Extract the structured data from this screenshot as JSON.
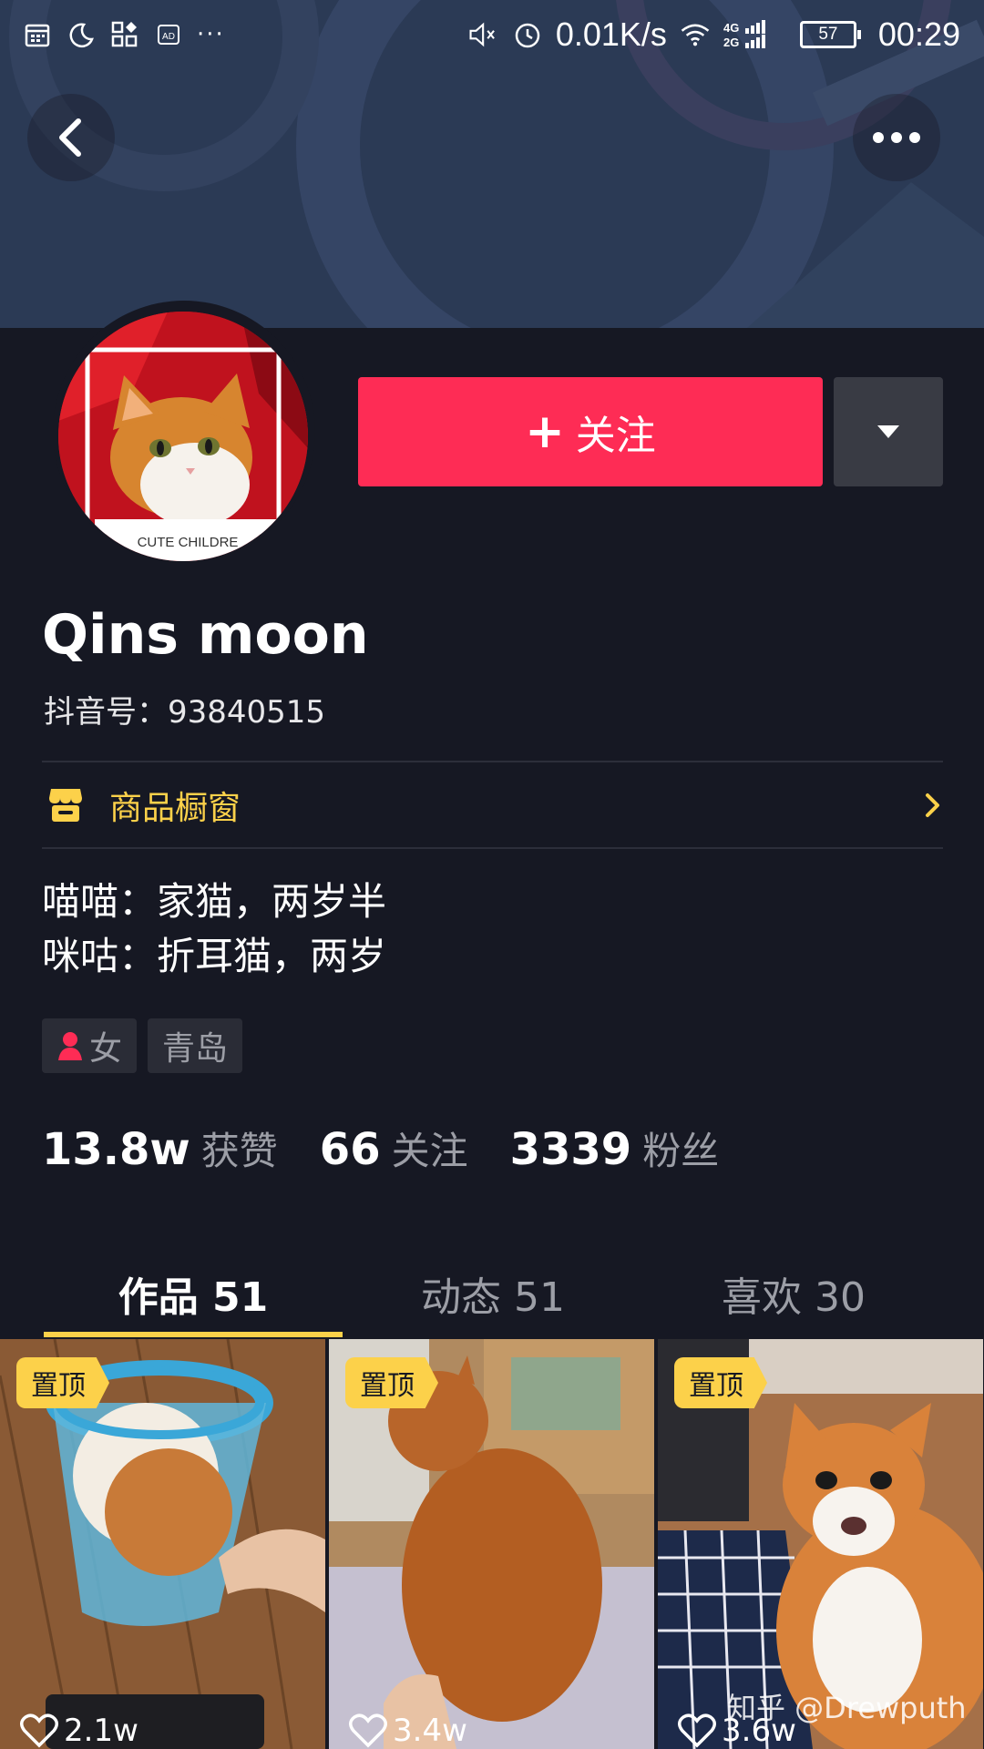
{
  "status_bar": {
    "speed": "0.01K/s",
    "network": "4G 2G",
    "battery": "57",
    "time": "00:29",
    "left_icons": [
      "calendar-icon",
      "moon-icon",
      "apps-icon",
      "ad-icon",
      "more-dots-icon"
    ],
    "right_icons": [
      "mute-icon",
      "alarm-icon",
      "wifi-icon",
      "signal-icon",
      "battery-icon"
    ]
  },
  "header": {
    "back_icon": "chevron-left-icon",
    "more_icon": "more-horizontal-icon"
  },
  "profile": {
    "avatar_caption": "CUTE CHILDRE",
    "follow_label": "关注",
    "follow_icon": "plus-icon",
    "dropdown_icon": "triangle-down-icon",
    "username": "Qins moon",
    "douyin_id": "抖音号：93840515"
  },
  "shop": {
    "label": "商品橱窗",
    "icon": "storefront-icon",
    "arrow_icon": "chevron-right-icon"
  },
  "bio": {
    "line1": "喵喵：家猫，两岁半",
    "line2": "咪咕：折耳猫，两岁"
  },
  "tags": {
    "gender": "女",
    "gender_icon": "female-user-icon",
    "city": "青岛"
  },
  "stats": {
    "likes_num": "13.8w",
    "likes_label": "获赞",
    "following_num": "66",
    "following_label": "关注",
    "followers_num": "3339",
    "followers_label": "粉丝"
  },
  "tabs": [
    {
      "label": "作品 51",
      "active": true
    },
    {
      "label": "动态 51",
      "active": false
    },
    {
      "label": "喜欢 30",
      "active": false
    }
  ],
  "videos": [
    {
      "pin": "置顶",
      "likes": "2.1w"
    },
    {
      "pin": "置顶",
      "likes": "3.4w"
    },
    {
      "pin": "置顶",
      "likes": "3.6w"
    }
  ],
  "watermark": "知乎 @Drewputh",
  "colors": {
    "background": "#161823",
    "banner": "#2b3a55",
    "accent_red": "#fe2c55",
    "accent_yellow": "#fcd14a",
    "muted_text": "#9c9ea6"
  }
}
